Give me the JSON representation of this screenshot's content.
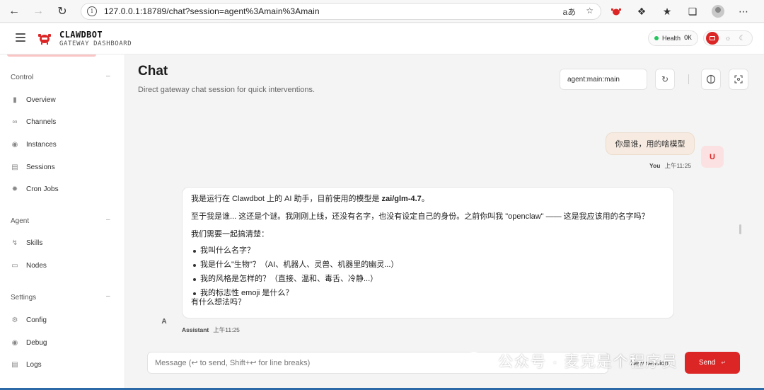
{
  "browser": {
    "url": "127.0.0.1:18789/chat?session=agent%3Amain%3Amain",
    "read_aloud_glyph": "aあ"
  },
  "header": {
    "brand_title": "CLAWDBOT",
    "brand_subtitle": "GATEWAY DASHBOARD",
    "health_label": "Health",
    "health_status": "OK",
    "accent_color": "#dc2626",
    "health_color": "#22c55e"
  },
  "sidebar": {
    "sections": [
      {
        "title": "Control",
        "items": [
          {
            "label": "Overview",
            "icon": "bar-chart-icon"
          },
          {
            "label": "Channels",
            "icon": "link-icon"
          },
          {
            "label": "Instances",
            "icon": "signal-icon"
          },
          {
            "label": "Sessions",
            "icon": "document-icon"
          },
          {
            "label": "Cron Jobs",
            "icon": "loader-icon"
          }
        ]
      },
      {
        "title": "Agent",
        "items": [
          {
            "label": "Skills",
            "icon": "lightning-icon"
          },
          {
            "label": "Nodes",
            "icon": "monitor-icon"
          }
        ]
      },
      {
        "title": "Settings",
        "items": [
          {
            "label": "Config",
            "icon": "gear-icon"
          },
          {
            "label": "Debug",
            "icon": "bug-icon"
          },
          {
            "label": "Logs",
            "icon": "file-icon"
          }
        ]
      }
    ]
  },
  "main": {
    "title": "Chat",
    "subtitle": "Direct gateway chat session for quick interventions.",
    "session_value": "agent:main:main"
  },
  "messages": {
    "user": {
      "text": "你是谁，用的啥模型",
      "sender": "You",
      "time": "上午11:25",
      "avatar_letter": "U"
    },
    "assistant": {
      "line1_prefix": "我是运行在 Clawdbot 上的 AI 助手，目前使用的模型是 ",
      "line1_model": "zai/glm-4.7",
      "line1_suffix": "。",
      "line2": "至于我是谁... 这还是个谜。我刚刚上线，还没有名字，也没有设定自己的身份。之前你叫我 \"openclaw\" —— 这是我应该用的名字吗？",
      "line3": "我们需要一起搞清楚：",
      "bullets": [
        "我叫什么名字？",
        "我是什么\"生物\"？（AI、机器人、灵兽、机器里的幽灵...）",
        "我的风格是怎样的？（直接、温和、毒舌、冷静...）",
        "我的标志性 emoji 是什么？"
      ],
      "closing": "有什么想法吗？",
      "sender": "Assistant",
      "time": "上午11:25",
      "avatar_letter": "A"
    }
  },
  "composer": {
    "placeholder": "Message (↩ to send, Shift+↩ for line breaks)",
    "new_session_label": "New session",
    "send_label": "Send",
    "send_kbd": "↵"
  },
  "watermark": {
    "text": "公众号 · 麦克是个程序员"
  }
}
